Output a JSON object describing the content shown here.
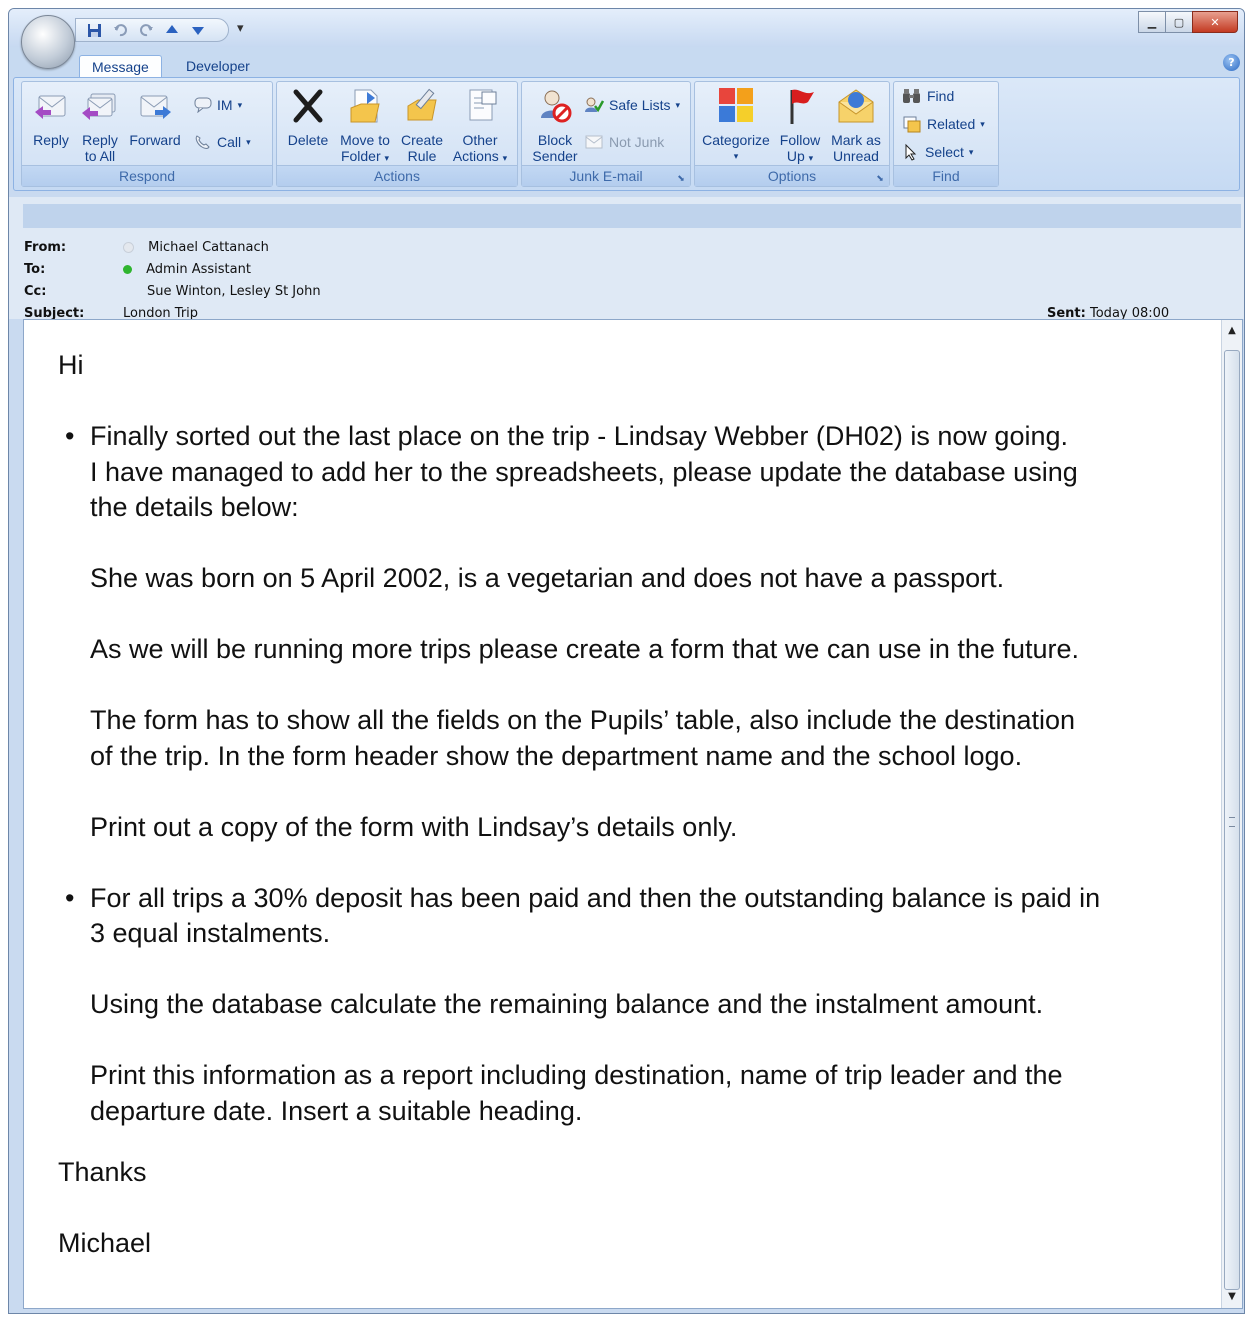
{
  "window": {
    "tabs": [
      {
        "label": "Message"
      },
      {
        "label": "Developer"
      }
    ]
  },
  "ribbon": {
    "respond": {
      "label": "Respond",
      "reply": "Reply",
      "reply_all_1": "Reply",
      "reply_all_2": "to All",
      "forward": "Forward",
      "im": "IM",
      "call": "Call"
    },
    "actions": {
      "label": "Actions",
      "delete": "Delete",
      "move_1": "Move to",
      "move_2": "Folder",
      "create_1": "Create",
      "create_2": "Rule",
      "other_1": "Other",
      "other_2": "Actions"
    },
    "junk": {
      "label": "Junk E-mail",
      "block_1": "Block",
      "block_2": "Sender",
      "safe_lists": "Safe Lists",
      "not_junk": "Not Junk"
    },
    "options": {
      "label": "Options",
      "categorize": "Categorize",
      "follow_1": "Follow",
      "follow_2": "Up",
      "mark_1": "Mark as",
      "mark_2": "Unread"
    },
    "find": {
      "label": "Find",
      "find": "Find",
      "related": "Related",
      "select": "Select"
    }
  },
  "header": {
    "from_label": "From:",
    "from": "Michael Cattanach",
    "to_label": "To:",
    "to": "Admin Assistant",
    "cc_label": "Cc:",
    "cc": "Sue Winton,  Lesley St John",
    "subject_label": "Subject:",
    "subject": "London Trip",
    "sent_label": "Sent:",
    "sent": "Today 08:00"
  },
  "message": {
    "greeting": "Hi",
    "bullet1_line1": "Finally sorted out the last place on the trip - Lindsay Webber (DH02) is now going.",
    "bullet1_line2": "I have managed to add her to the spreadsheets, please update the database using",
    "bullet1_line3": "the details below:",
    "para1": "She was born on 5 April 2002, is a vegetarian and does not have a passport.",
    "para2": "As we will be running more trips please create a form that we can use in the future.",
    "para3_line1": "The form has to show all the fields on the Pupils’ table, also include the destination",
    "para3_line2": "of the trip. In the form header show the department name and the school logo.",
    "para4": "Print out a copy of the form with Lindsay’s details only.",
    "bullet2_line1": "For all trips a 30% deposit has been paid and then the outstanding balance is paid in",
    "bullet2_line2": "3 equal instalments.",
    "para5": "Using the database calculate the remaining balance and the instalment amount.",
    "para6_line1": "Print this information as a report including destination, name of trip leader and the",
    "para6_line2": "departure date. Insert a suitable heading.",
    "thanks": "Thanks",
    "signature": "Michael",
    "bullet_glyph": "•"
  },
  "colors": {
    "ribbon_text": "#15428b",
    "group_label": "#3e6aaa",
    "presence_online": "#2fb52f",
    "presence_unknown": "#cfd6df"
  }
}
